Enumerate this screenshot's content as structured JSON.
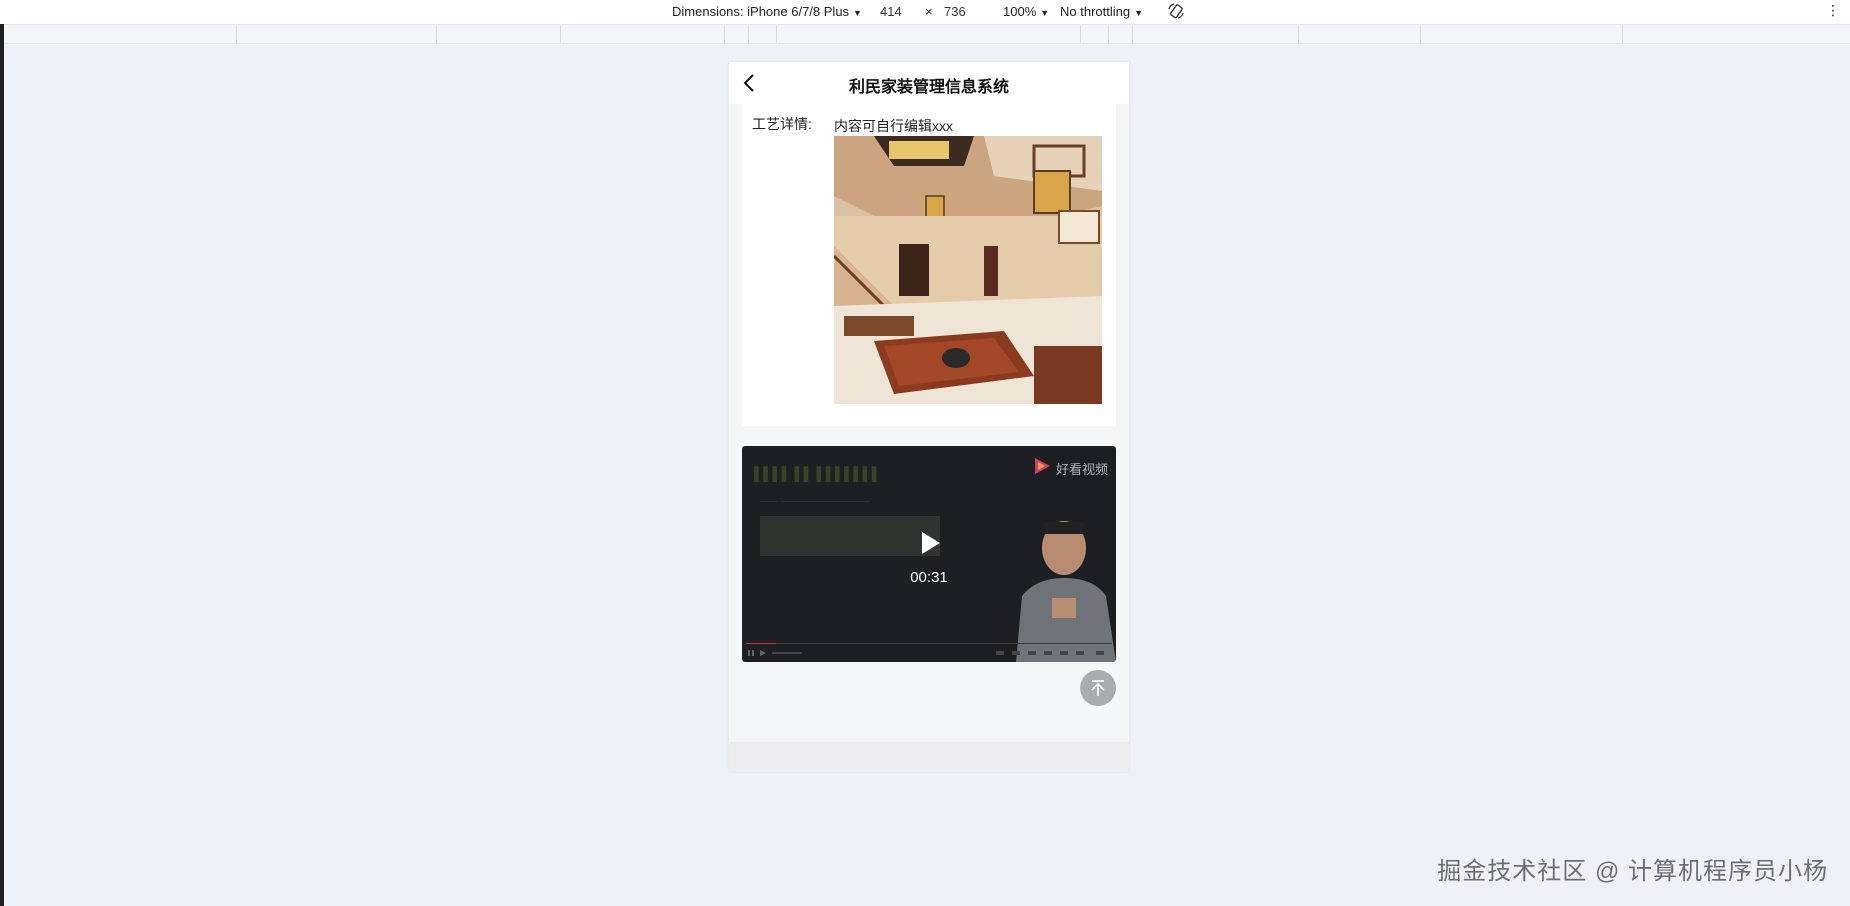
{
  "devtools": {
    "device_label": "Dimensions: iPhone 6/7/8 Plus",
    "width": "414",
    "times": "×",
    "height": "736",
    "zoom": "100%",
    "throttle": "No throttling"
  },
  "app": {
    "title": "利民家装管理信息系统"
  },
  "detail": {
    "label": "工艺详情:",
    "text": "内容可自行编辑xxx"
  },
  "video": {
    "brand": "好看视频",
    "duration": "00:31"
  },
  "watermark": "掘金技术社区 @ 计算机程序员小杨"
}
